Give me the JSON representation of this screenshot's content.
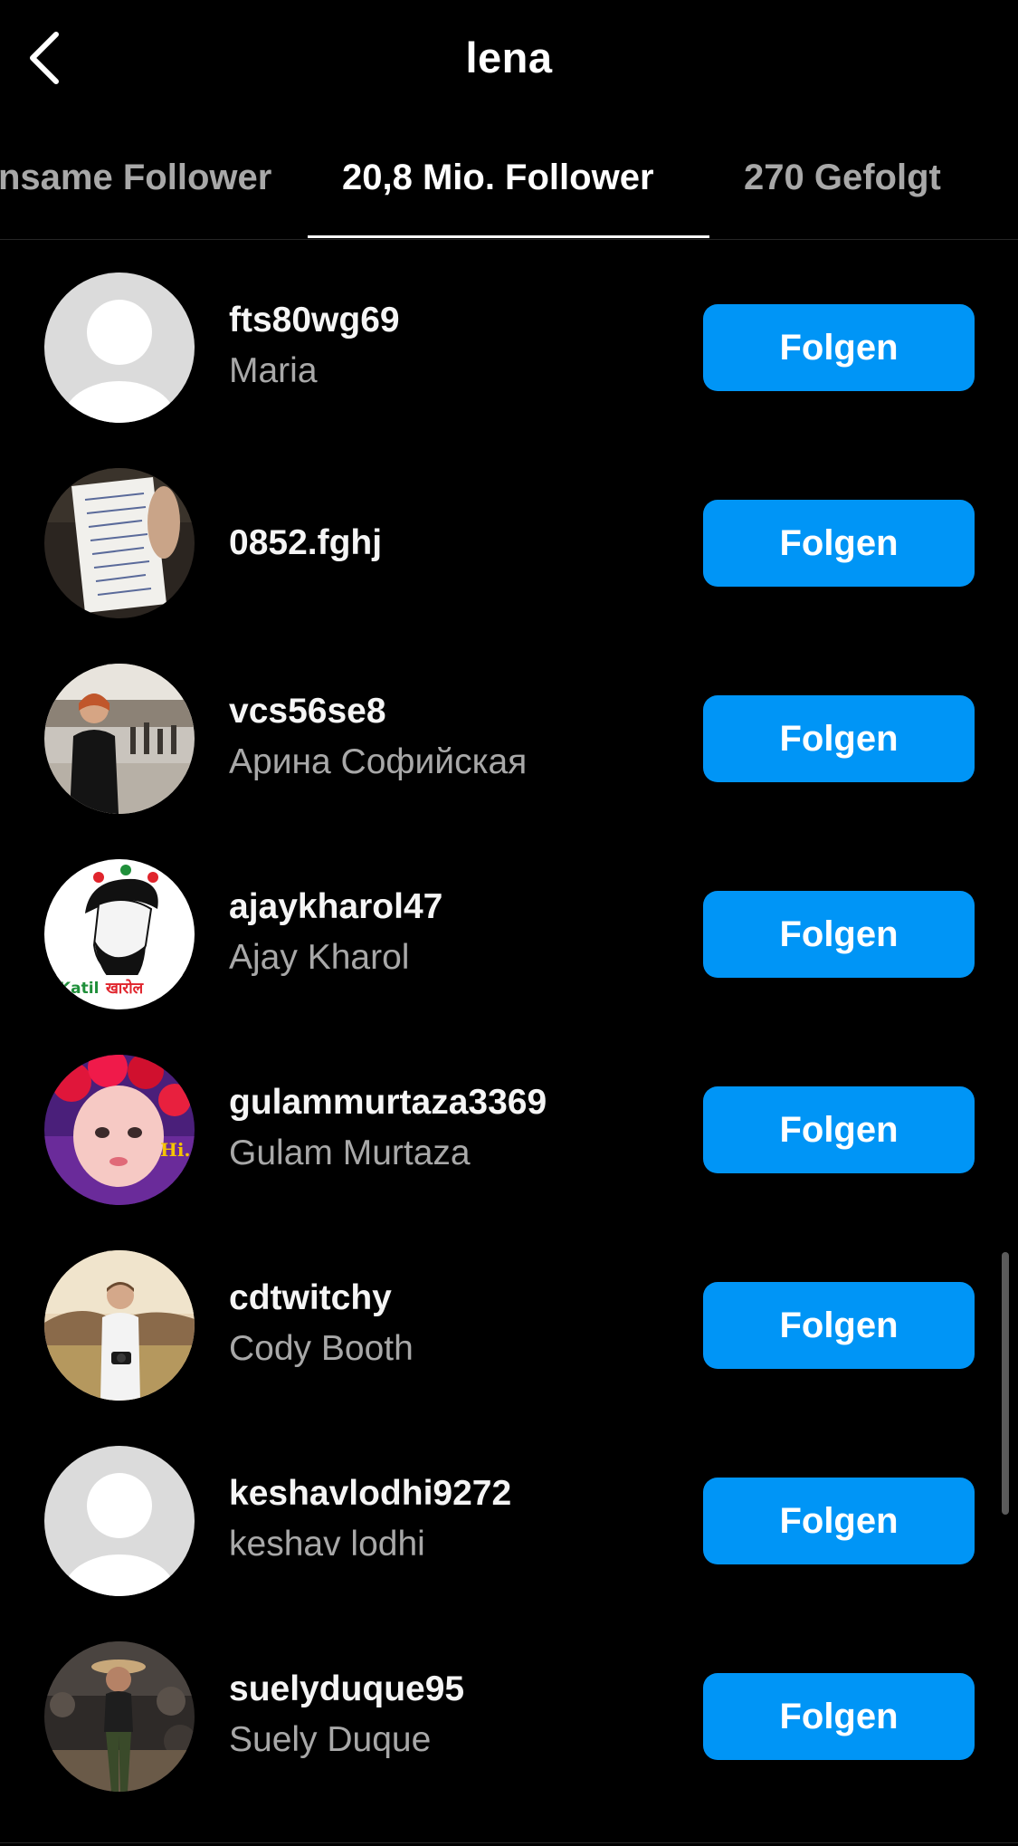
{
  "header": {
    "title": "lena",
    "back_icon": "chevron-left-icon"
  },
  "tabs": [
    {
      "label": "Gemeinsame Follower",
      "visible_label": "nsame Follower",
      "active": false
    },
    {
      "label": "20,8 Mio. Follower",
      "active": true
    },
    {
      "label": "270 Gefolgt",
      "active": false
    }
  ],
  "followers": [
    {
      "username": "fts80wg69",
      "fullname": "Maria",
      "avatar": "default-avatar-icon",
      "button": "Folgen"
    },
    {
      "username": "0852.fghj",
      "fullname": "",
      "avatar": "photo-handwritten-note",
      "button": "Folgen"
    },
    {
      "username": "vcs56se8",
      "fullname": "Арина Софийская",
      "avatar": "photo-woman-in-park",
      "button": "Folgen"
    },
    {
      "username": "ajaykharol47",
      "fullname": "Ajay Kharol",
      "avatar": "illustration-bearded-man-logo",
      "button": "Folgen"
    },
    {
      "username": "gulammurtaza3369",
      "fullname": "Gulam Murtaza",
      "avatar": "photo-child-with-flowers",
      "button": "Folgen"
    },
    {
      "username": "cdtwitchy",
      "fullname": "Cody Booth",
      "avatar": "photo-man-with-camera",
      "button": "Folgen"
    },
    {
      "username": "keshavlodhi9272",
      "fullname": "keshav lodhi",
      "avatar": "default-avatar-icon",
      "button": "Folgen"
    },
    {
      "username": "suelyduque95",
      "fullname": "Suely Duque",
      "avatar": "photo-woman-at-event",
      "button": "Folgen"
    }
  ],
  "colors": {
    "background": "#000000",
    "accent_button": "#0095f6",
    "secondary_text": "#a8a8a8"
  }
}
